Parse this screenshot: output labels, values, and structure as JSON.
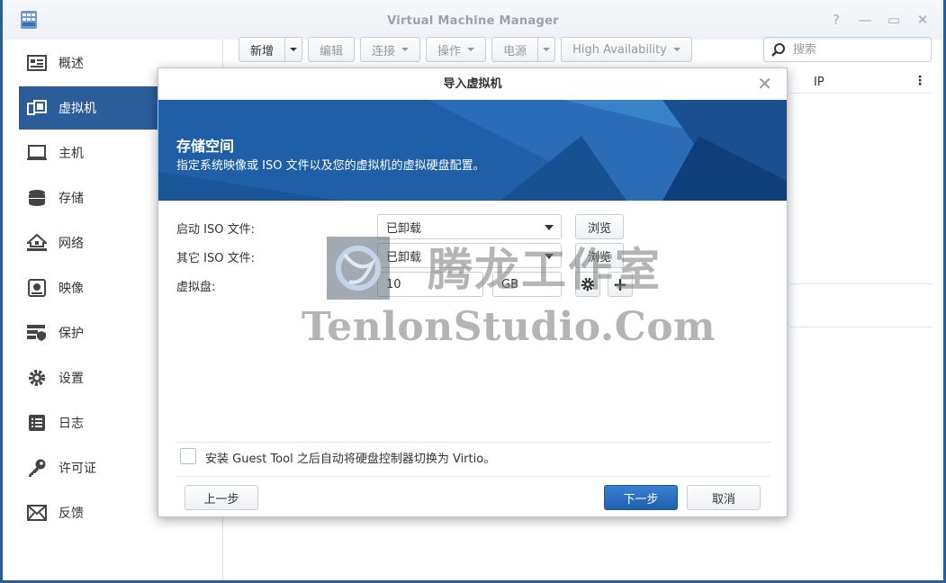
{
  "window": {
    "title": "Virtual Machine Manager",
    "controls": [
      "?",
      "—",
      "▭",
      "✕"
    ]
  },
  "sidebar": {
    "items": [
      {
        "label": "概述",
        "icon": "overview-icon"
      },
      {
        "label": "虚拟机",
        "icon": "vm-icon",
        "active": true
      },
      {
        "label": "主机",
        "icon": "host-icon"
      },
      {
        "label": "存储",
        "icon": "storage-icon"
      },
      {
        "label": "网络",
        "icon": "network-icon"
      },
      {
        "label": "映像",
        "icon": "image-icon"
      },
      {
        "label": "保护",
        "icon": "protection-icon"
      },
      {
        "label": "设置",
        "icon": "gear-icon"
      },
      {
        "label": "日志",
        "icon": "log-icon"
      },
      {
        "label": "许可证",
        "icon": "key-icon"
      },
      {
        "label": "反馈",
        "icon": "mail-icon"
      }
    ]
  },
  "toolbar": {
    "new": "新增",
    "edit": "编辑",
    "connect": "连接",
    "action": "操作",
    "power": "电源",
    "ha": "High Availability"
  },
  "search": {
    "placeholder": "搜索"
  },
  "grid": {
    "col_ip": "IP"
  },
  "dialog": {
    "title": "导入虚拟机",
    "banner_title": "存储空间",
    "banner_subtitle": "指定系统映像或 ISO 文件以及您的虚拟机的虚拟硬盘配置。",
    "boot_iso_label": "启动 ISO 文件:",
    "boot_iso_value": "已卸载",
    "other_iso_label": "其它 ISO 文件:",
    "other_iso_value": "已卸载",
    "browse": "浏览",
    "vdisk_label": "虚拟盘:",
    "vdisk_size": "10",
    "vdisk_unit": "GB",
    "guest_tool_label": "安装 Guest Tool 之后自动将硬盘控制器切换为 Virtio。",
    "prev": "上一步",
    "next": "下一步",
    "cancel": "取消"
  },
  "watermark": {
    "cn": "腾龙工作室",
    "en": "TenlonStudio.Com"
  },
  "colors": {
    "accent": "#2a5d9a",
    "banner": "#1e5fa8",
    "primary": "#2468bf"
  }
}
